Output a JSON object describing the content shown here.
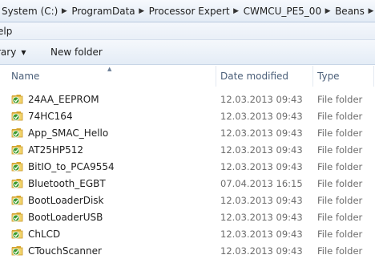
{
  "address": {
    "crumbs": [
      "System (C:)",
      "ProgramData",
      "Processor Expert",
      "CWMCU_PE5_00",
      "Beans"
    ]
  },
  "menubar": {
    "help_label": "elp"
  },
  "toolbar": {
    "library_label": "rary",
    "new_folder_label": "New folder"
  },
  "columns": {
    "name": "Name",
    "date": "Date modified",
    "type": "Type"
  },
  "files": [
    {
      "name": "24AA_EEPROM",
      "date": "12.03.2013 09:43",
      "type": "File folder"
    },
    {
      "name": "74HC164",
      "date": "12.03.2013 09:43",
      "type": "File folder"
    },
    {
      "name": "App_SMAC_Hello",
      "date": "12.03.2013 09:43",
      "type": "File folder"
    },
    {
      "name": "AT25HP512",
      "date": "12.03.2013 09:43",
      "type": "File folder"
    },
    {
      "name": "BitIO_to_PCA9554",
      "date": "12.03.2013 09:43",
      "type": "File folder"
    },
    {
      "name": "Bluetooth_EGBT",
      "date": "07.04.2013 16:15",
      "type": "File folder"
    },
    {
      "name": "BootLoaderDisk",
      "date": "12.03.2013 09:43",
      "type": "File folder"
    },
    {
      "name": "BootLoaderUSB",
      "date": "12.03.2013 09:43",
      "type": "File folder"
    },
    {
      "name": "ChLCD",
      "date": "12.03.2013 09:43",
      "type": "File folder"
    },
    {
      "name": "CTouchScanner",
      "date": "12.03.2013 09:43",
      "type": "File folder"
    }
  ],
  "icons": {
    "folder": "synced-folder-icon",
    "separator": "chevron-right-icon",
    "dropdown": "caret-down-icon"
  },
  "colors": {
    "folder_yellow": "#e8c64a",
    "sync_green": "#3c9a2a",
    "header_text": "#4c607a"
  }
}
